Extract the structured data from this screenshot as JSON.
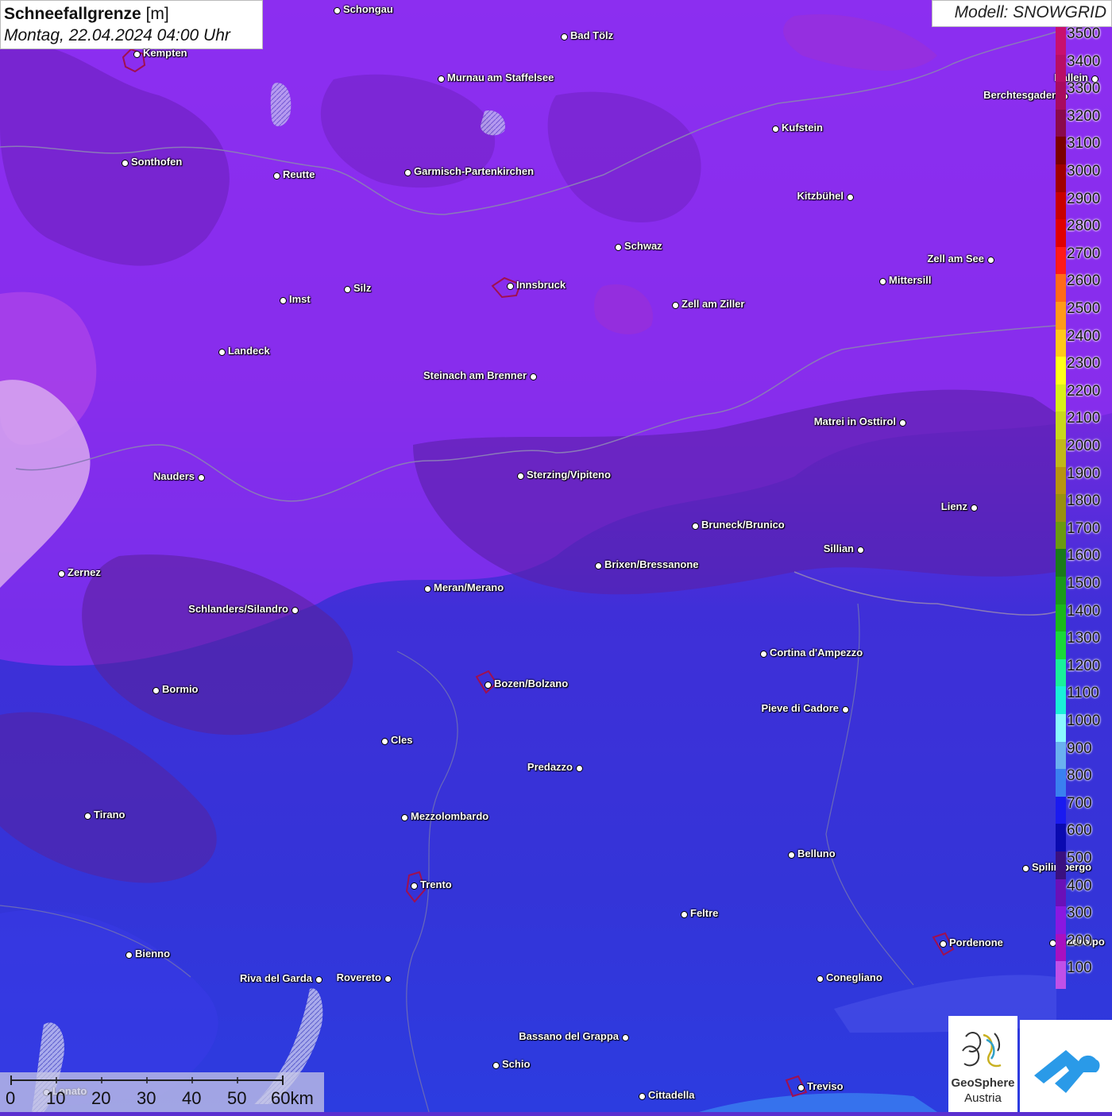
{
  "title": {
    "main": "Schneefallgrenze",
    "unit": "[m]",
    "datetime": "Montag, 22.04.2024 04:00 Uhr"
  },
  "model": "Modell: SNOWGRID",
  "legend": {
    "entries": [
      {
        "label": "3500",
        "color": "#c8106e"
      },
      {
        "label": "3400",
        "color": "#b80e66"
      },
      {
        "label": "3300",
        "color": "#a80b5e"
      },
      {
        "label": "3200",
        "color": "#8a0a4c"
      },
      {
        "label": "3100",
        "color": "#7a0000"
      },
      {
        "label": "3000",
        "color": "#a00000"
      },
      {
        "label": "2900",
        "color": "#c80000"
      },
      {
        "label": "2800",
        "color": "#e00000"
      },
      {
        "label": "2700",
        "color": "#ff1a1a"
      },
      {
        "label": "2600",
        "color": "#ff6a1a"
      },
      {
        "label": "2500",
        "color": "#ff9a1a"
      },
      {
        "label": "2400",
        "color": "#ffc81a"
      },
      {
        "label": "2300",
        "color": "#ffff1a"
      },
      {
        "label": "2200",
        "color": "#d8f01a"
      },
      {
        "label": "2100",
        "color": "#c8d81a"
      },
      {
        "label": "2000",
        "color": "#c0b818"
      },
      {
        "label": "1900",
        "color": "#b89410"
      },
      {
        "label": "1800",
        "color": "#989010"
      },
      {
        "label": "1700",
        "color": "#6a9a10"
      },
      {
        "label": "1600",
        "color": "#1a7a1a"
      },
      {
        "label": "1500",
        "color": "#1a9a1a"
      },
      {
        "label": "1400",
        "color": "#1ab81a"
      },
      {
        "label": "1300",
        "color": "#1ad83a"
      },
      {
        "label": "1200",
        "color": "#1af09a"
      },
      {
        "label": "1100",
        "color": "#1af0d8"
      },
      {
        "label": "1000",
        "color": "#8af8ff"
      },
      {
        "label": "900",
        "color": "#6ab0f0"
      },
      {
        "label": "800",
        "color": "#3a80f0"
      },
      {
        "label": "700",
        "color": "#1a1af0"
      },
      {
        "label": "600",
        "color": "#0a0ab0"
      },
      {
        "label": "500",
        "color": "#3a1080"
      },
      {
        "label": "400",
        "color": "#6a10b8"
      },
      {
        "label": "300",
        "color": "#8a18e0"
      },
      {
        "label": "200",
        "color": "#a810c0"
      },
      {
        "label": "100",
        "color": "#c050e8"
      }
    ]
  },
  "cities": [
    {
      "name": "Schongau"
    },
    {
      "name": "Bad Tölz"
    },
    {
      "name": "Kempten"
    },
    {
      "name": "Murnau am Staffelsee"
    },
    {
      "name": "Hallein"
    },
    {
      "name": "Berchtesgaden"
    },
    {
      "name": "Kufstein"
    },
    {
      "name": "Sonthofen"
    },
    {
      "name": "Reutte"
    },
    {
      "name": "Garmisch-Partenkirchen"
    },
    {
      "name": "Kitzbühel"
    },
    {
      "name": "Schwaz"
    },
    {
      "name": "Zell am See"
    },
    {
      "name": "Mittersill"
    },
    {
      "name": "Imst"
    },
    {
      "name": "Silz"
    },
    {
      "name": "Innsbruck"
    },
    {
      "name": "Zell am Ziller"
    },
    {
      "name": "Landeck"
    },
    {
      "name": "Steinach am Brenner"
    },
    {
      "name": "Matrei in Osttirol"
    },
    {
      "name": "Nauders"
    },
    {
      "name": "Sterzing/Vipiteno"
    },
    {
      "name": "Lienz"
    },
    {
      "name": "Bruneck/Brunico"
    },
    {
      "name": "Sillian"
    },
    {
      "name": "Zernez"
    },
    {
      "name": "Brixen/Bressanone"
    },
    {
      "name": "Meran/Merano"
    },
    {
      "name": "Schlanders/Silandro"
    },
    {
      "name": "Cortina d'Ampezzo"
    },
    {
      "name": "Bozen/Bolzano"
    },
    {
      "name": "Bormio"
    },
    {
      "name": "Pieve di Cadore"
    },
    {
      "name": "Cles"
    },
    {
      "name": "Predazzo"
    },
    {
      "name": "Tirano"
    },
    {
      "name": "Mezzolombardo"
    },
    {
      "name": "Belluno"
    },
    {
      "name": "Spilimbergo"
    },
    {
      "name": "Trento"
    },
    {
      "name": "Feltre"
    },
    {
      "name": "Pordenone"
    },
    {
      "name": "Codroipo"
    },
    {
      "name": "Bienno"
    },
    {
      "name": "Riva del Garda"
    },
    {
      "name": "Rovereto"
    },
    {
      "name": "Conegliano"
    },
    {
      "name": "Bassano del Grappa"
    },
    {
      "name": "Schio"
    },
    {
      "name": "Lonato"
    },
    {
      "name": "Cittadella"
    },
    {
      "name": "Treviso"
    }
  ],
  "scale_bar": {
    "labels": [
      "0",
      "10",
      "20",
      "30",
      "40",
      "50",
      "60km"
    ]
  },
  "logos": {
    "geosphere_line1": "GeoSphere",
    "geosphere_line2": "Austria"
  }
}
